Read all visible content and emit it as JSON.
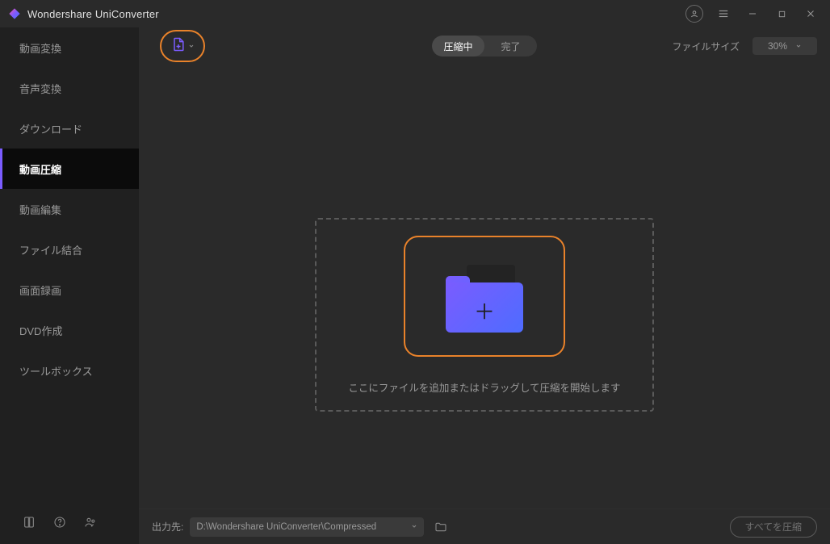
{
  "app": {
    "title": "Wondershare UniConverter"
  },
  "sidebar": {
    "items": [
      {
        "label": "動画変換",
        "active": false
      },
      {
        "label": "音声変換",
        "active": false
      },
      {
        "label": "ダウンロード",
        "active": false
      },
      {
        "label": "動画圧縮",
        "active": true
      },
      {
        "label": "動画編集",
        "active": false
      },
      {
        "label": "ファイル結合",
        "active": false
      },
      {
        "label": "画面録画",
        "active": false
      },
      {
        "label": "DVD作成",
        "active": false
      },
      {
        "label": "ツールボックス",
        "active": false
      }
    ]
  },
  "toolbar": {
    "tabs": {
      "compressing": "圧縮中",
      "done": "完了"
    },
    "fileSizeLabel": "ファイルサイズ",
    "fileSizeValue": "30%"
  },
  "dropzone": {
    "hint": "ここにファイルを追加またはドラッグして圧縮を開始します"
  },
  "bottom": {
    "outLabel": "出力先:",
    "outPath": "D:\\Wondershare UniConverter\\Compressed",
    "compressAll": "すべてを圧縮"
  }
}
